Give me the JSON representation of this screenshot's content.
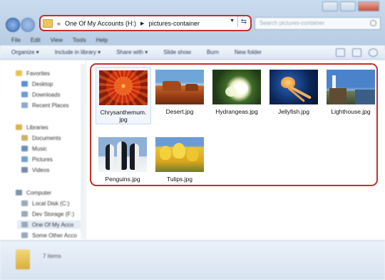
{
  "address": {
    "overflow": "«",
    "segments": [
      "One Of My Accounts (H:)",
      "pictures-container"
    ]
  },
  "search": {
    "placeholder": "Search pictures-container"
  },
  "menu": [
    "File",
    "Edit",
    "View",
    "Tools",
    "Help"
  ],
  "commands": [
    "Organize ▾",
    "Include in library ▾",
    "Share with ▾",
    "Slide show",
    "Burn",
    "New folder"
  ],
  "sidebar": {
    "favorites": {
      "header": "Favorites",
      "items": [
        "Desktop",
        "Downloads",
        "Recent Places"
      ]
    },
    "libraries": {
      "header": "Libraries",
      "items": [
        "Documents",
        "Music",
        "Pictures",
        "Videos"
      ]
    },
    "computer": {
      "header": "Computer",
      "items": [
        "Local Disk (C:)",
        "Dev Storage (F:)",
        "One Of My Acco",
        "Some Other Acco"
      ]
    }
  },
  "files": [
    {
      "name": "Chrysanthemum.jpg",
      "line1": "Chrysanthemum.",
      "line2": "jpg",
      "image": "chrysanthemum"
    },
    {
      "name": "Desert.jpg",
      "image": "desert"
    },
    {
      "name": "Hydrangeas.jpg",
      "image": "hydrangeas"
    },
    {
      "name": "Jellyfish.jpg",
      "image": "jellyfish"
    },
    {
      "name": "Lighthouse.jpg",
      "image": "lighthouse"
    },
    {
      "name": "Penguins.jpg",
      "image": "penguins"
    },
    {
      "name": "Tulips.jpg",
      "image": "tulips"
    }
  ],
  "status": {
    "count": "7 items"
  },
  "colors": {
    "highlight": "#c43030",
    "accent": "#3c6fb6"
  }
}
